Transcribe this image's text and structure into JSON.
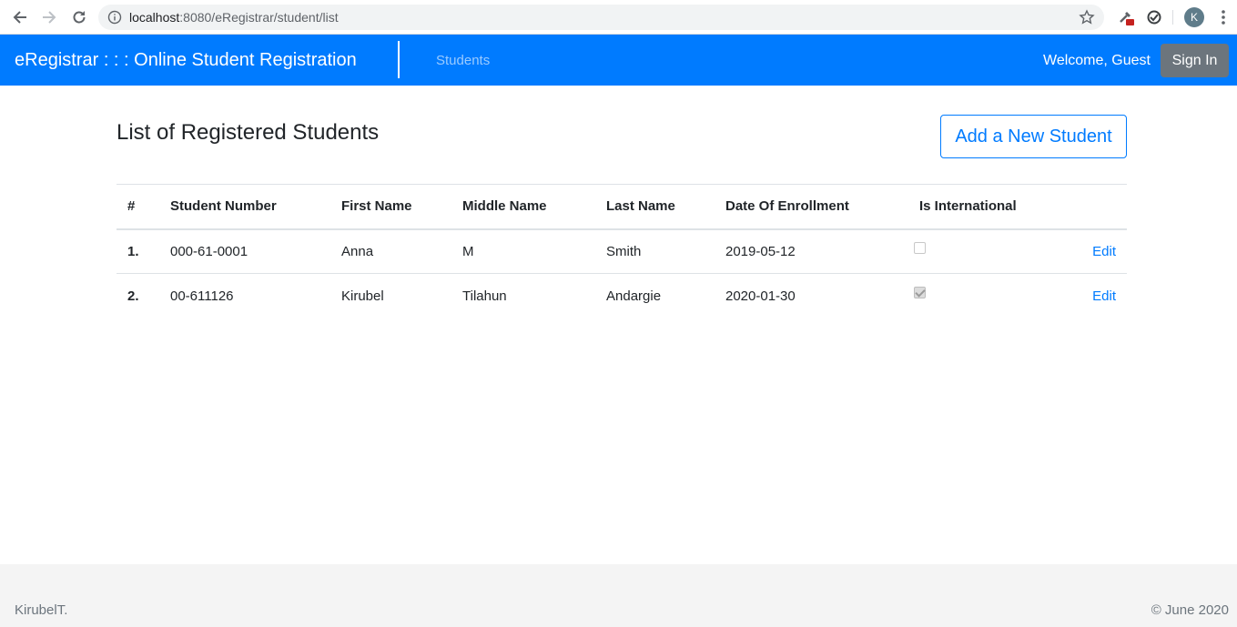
{
  "browser": {
    "url_host": "localhost",
    "url_path": ":8080/eRegistrar/student/list",
    "avatar_letter": "K"
  },
  "navbar": {
    "brand": "eRegistrar : : : Online Student Registration",
    "nav_link": "Students",
    "welcome": "Welcome, Guest",
    "signin_label": "Sign In",
    "background": "#007bff"
  },
  "main": {
    "title": "List of Registered Students",
    "add_button": "Add a New Student",
    "table": {
      "headers": [
        "#",
        "Student Number",
        "First Name",
        "Middle Name",
        "Last Name",
        "Date Of Enrollment",
        "Is International",
        ""
      ],
      "rows": [
        {
          "index": "1.",
          "student_number": "000-61-0001",
          "first_name": "Anna",
          "middle_name": "M",
          "last_name": "Smith",
          "date_of_enrollment": "2019-05-12",
          "is_international": false,
          "action": "Edit"
        },
        {
          "index": "2.",
          "student_number": "00-611126",
          "first_name": "Kirubel",
          "middle_name": "Tilahun",
          "last_name": "Andargie",
          "date_of_enrollment": "2020-01-30",
          "is_international": true,
          "action": "Edit"
        }
      ]
    }
  },
  "footer": {
    "left": "KirubelT.",
    "right": "© June 2020"
  }
}
